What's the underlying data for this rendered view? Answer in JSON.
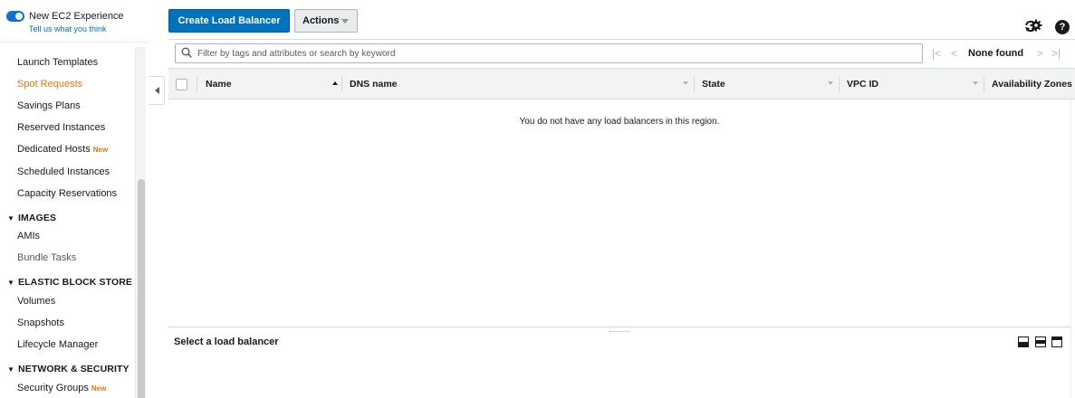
{
  "experience": {
    "title": "New EC2 Experience",
    "link": "Tell us what you think",
    "enabled": true
  },
  "sidebar": {
    "items": [
      {
        "label": "Launch Templates"
      },
      {
        "label": "Spot Requests",
        "active": true
      },
      {
        "label": "Savings Plans"
      },
      {
        "label": "Reserved Instances"
      },
      {
        "label": "Dedicated Hosts",
        "badge": "New"
      },
      {
        "label": "Scheduled Instances"
      },
      {
        "label": "Capacity Reservations"
      }
    ],
    "sections": [
      {
        "title": "IMAGES",
        "items": [
          {
            "label": "AMIs"
          },
          {
            "label": "Bundle Tasks"
          }
        ]
      },
      {
        "title": "ELASTIC BLOCK STORE",
        "items": [
          {
            "label": "Volumes"
          },
          {
            "label": "Snapshots"
          },
          {
            "label": "Lifecycle Manager"
          }
        ]
      },
      {
        "title": "NETWORK & SECURITY",
        "items": [
          {
            "label": "Security Groups",
            "badge": "New"
          }
        ]
      }
    ]
  },
  "toolbar": {
    "create_label": "Create Load Balancer",
    "actions_label": "Actions"
  },
  "search": {
    "placeholder": "Filter by tags and attributes or search by keyword",
    "value": ""
  },
  "pager": {
    "status": "None found"
  },
  "table": {
    "columns": [
      "Name",
      "DNS name",
      "State",
      "VPC ID",
      "Availability Zones"
    ],
    "sorted_column": "Name",
    "rows": [],
    "empty_message": "You do not have any load balancers in this region."
  },
  "details": {
    "title": "Select a load balancer"
  },
  "colors": {
    "primary": "#0073bb",
    "active_nav": "#ec7211",
    "toggle": "#0a72d3"
  }
}
